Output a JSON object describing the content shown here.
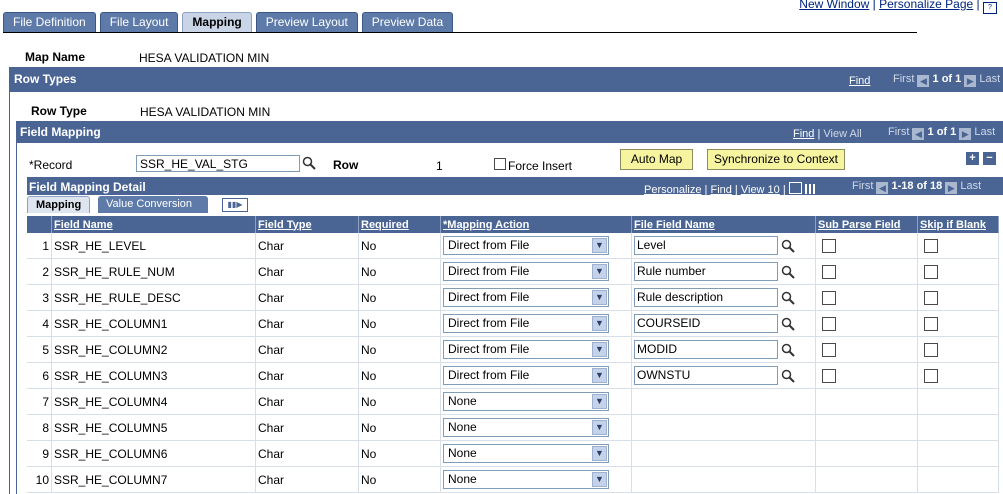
{
  "top_links": {
    "new_window": "New Window",
    "separator": "|",
    "personalize_page": "Personalize Page",
    "separator2": "|"
  },
  "tabs": [
    "File Definition",
    "File Layout",
    "Mapping",
    "Preview Layout",
    "Preview Data"
  ],
  "active_tab": "Mapping",
  "map_name": {
    "label": "Map Name",
    "value": "HESA VALIDATION MIN"
  },
  "row_types": {
    "title": "Row Types",
    "find": "Find",
    "first": "First",
    "count": "1 of 1",
    "last": "Last",
    "row_type_label": "Row Type",
    "row_type_value": "HESA VALIDATION MIN"
  },
  "field_mapping": {
    "title": "Field Mapping",
    "find": "Find",
    "sep": "|",
    "view_all": "View All",
    "first": "First",
    "count": "1 of 1",
    "last": "Last",
    "record_label": "*Record",
    "record_value": "SSR_HE_VAL_STG",
    "row_label": "Row",
    "row_value": "1",
    "force_insert_label": "Force Insert",
    "auto_map_label": "Auto Map",
    "sync_label": "Synchronize to Context"
  },
  "detail": {
    "title": "Field Mapping Detail",
    "personalize": "Personalize",
    "find": "Find",
    "view10": "View 10",
    "first": "First",
    "count": "1-18 of 18",
    "last": "Last",
    "subtabs": [
      "Mapping",
      "Value Conversion"
    ],
    "columns": [
      "Field Name",
      "Field Type",
      "Required",
      "*Mapping Action",
      "File Field Name",
      "Sub Parse Field",
      "Skip if Blank"
    ],
    "rows": [
      {
        "n": "1",
        "field": "SSR_HE_LEVEL",
        "type": "Char",
        "req": "No",
        "action": "Direct from File",
        "file_field": "Level"
      },
      {
        "n": "2",
        "field": "SSR_HE_RULE_NUM",
        "type": "Char",
        "req": "No",
        "action": "Direct from File",
        "file_field": "Rule number"
      },
      {
        "n": "3",
        "field": "SSR_HE_RULE_DESC",
        "type": "Char",
        "req": "No",
        "action": "Direct from File",
        "file_field": "Rule description"
      },
      {
        "n": "4",
        "field": "SSR_HE_COLUMN1",
        "type": "Char",
        "req": "No",
        "action": "Direct from File",
        "file_field": "COURSEID"
      },
      {
        "n": "5",
        "field": "SSR_HE_COLUMN2",
        "type": "Char",
        "req": "No",
        "action": "Direct from File",
        "file_field": "MODID"
      },
      {
        "n": "6",
        "field": "SSR_HE_COLUMN3",
        "type": "Char",
        "req": "No",
        "action": "Direct from File",
        "file_field": "OWNSTU"
      },
      {
        "n": "7",
        "field": "SSR_HE_COLUMN4",
        "type": "Char",
        "req": "No",
        "action": "None",
        "file_field": ""
      },
      {
        "n": "8",
        "field": "SSR_HE_COLUMN5",
        "type": "Char",
        "req": "No",
        "action": "None",
        "file_field": ""
      },
      {
        "n": "9",
        "field": "SSR_HE_COLUMN6",
        "type": "Char",
        "req": "No",
        "action": "None",
        "file_field": ""
      },
      {
        "n": "10",
        "field": "SSR_HE_COLUMN7",
        "type": "Char",
        "req": "No",
        "action": "None",
        "file_field": ""
      }
    ]
  },
  "colors": {
    "header_bg": "#4a6594",
    "tab_bg": "#5d7aa8",
    "button_bg": "#f7f4a0",
    "link": "#00247d"
  }
}
